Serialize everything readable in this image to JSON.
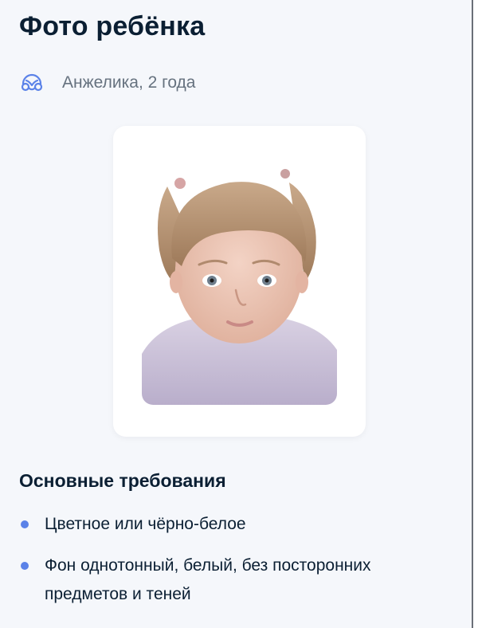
{
  "header": {
    "title": "Фото ребёнка"
  },
  "child": {
    "icon": "child-icon",
    "label": "Анжелика, 2 года"
  },
  "photo": {
    "alt_icon": "child-portrait-photo"
  },
  "requirements": {
    "title": "Основные требования",
    "items": [
      "Цветное или чёрно-белое",
      "Фон однотонный, белый, без посторонних предметов и теней"
    ]
  },
  "colors": {
    "accent": "#5b82e8",
    "text": "#0b1f33",
    "muted": "#66727f",
    "background": "#f5f7fb"
  }
}
